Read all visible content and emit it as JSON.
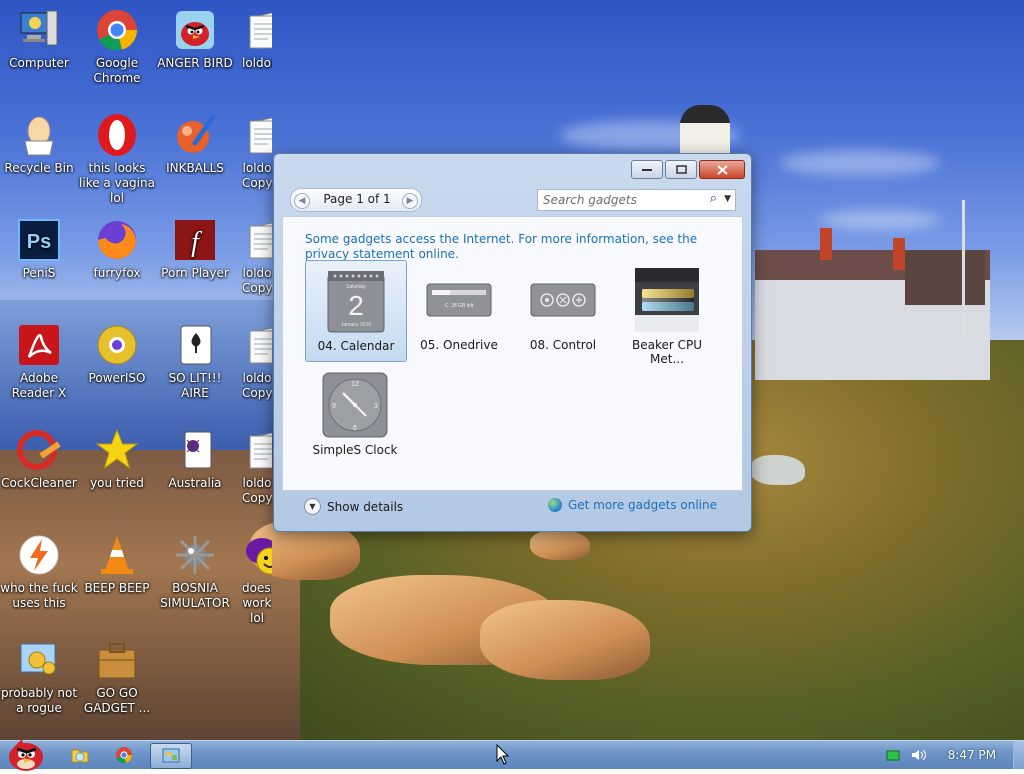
{
  "desktop": {
    "icons": [
      {
        "label": "Computer",
        "icon": "computer-icon"
      },
      {
        "label": "Google Chrome",
        "icon": "chrome-icon"
      },
      {
        "label": "ANGER BIRD",
        "icon": "angry-bird-icon"
      },
      {
        "label": "loldongs.txt",
        "icon": "text-file-icon"
      },
      {
        "label": "Recycle Bin",
        "icon": "recycle-bin-icon"
      },
      {
        "label": "this looks like a vagina lol",
        "icon": "opera-icon"
      },
      {
        "label": "INKBALLS",
        "icon": "inkball-icon"
      },
      {
        "label": "loldo Copy",
        "icon": "text-file-icon"
      },
      {
        "label": "PeniS",
        "icon": "photoshop-icon"
      },
      {
        "label": "furryfox",
        "icon": "firefox-icon"
      },
      {
        "label": "Porn Player",
        "icon": "flash-player-icon"
      },
      {
        "label": "loldo Copy",
        "icon": "text-file-icon"
      },
      {
        "label": "Adobe Reader X",
        "icon": "adobe-reader-icon"
      },
      {
        "label": "PowerISO",
        "icon": "poweriso-disc-icon"
      },
      {
        "label": "SO LIT!!! AIRE",
        "icon": "playing-card-icon"
      },
      {
        "label": "loldo Copy",
        "icon": "text-file-icon"
      },
      {
        "label": "CockCleaner",
        "icon": "ccleaner-icon"
      },
      {
        "label": "you tried",
        "icon": "star-icon"
      },
      {
        "label": "Australia",
        "icon": "spider-solitaire-icon"
      },
      {
        "label": "loldo Copy",
        "icon": "text-file-icon"
      },
      {
        "label": "who the fuck uses this",
        "icon": "lightning-icon"
      },
      {
        "label": "BEEP BEEP",
        "icon": "vlc-cone-icon"
      },
      {
        "label": "BOSNIA SIMULATOR",
        "icon": "minesweeper-mine-icon"
      },
      {
        "label": "doesn't work lol",
        "icon": "yahoo-messenger-icon"
      },
      {
        "label": "probably not a rogue",
        "icon": "control-panel-icon"
      },
      {
        "label": "GO GO GADGET ...",
        "icon": "gadget-briefcase-icon"
      }
    ]
  },
  "window": {
    "pager": {
      "label": "Page 1 of 1"
    },
    "search": {
      "placeholder": "Search gadgets"
    },
    "info_text": "Some gadgets access the Internet.  For more information, see the privacy statement online.",
    "gadgets": [
      {
        "label": "04. Calendar",
        "selected": true,
        "calendar_day": "2",
        "calendar_top": "Saturday",
        "calendar_bottom": "January 2010"
      },
      {
        "label": "05. Onedrive",
        "selected": false,
        "drive_text": "C: 28 GB left"
      },
      {
        "label": "08. Control",
        "selected": false
      },
      {
        "label": "Beaker CPU Met...",
        "selected": false
      },
      {
        "label": "SimpleS Clock",
        "selected": false
      }
    ],
    "footer": {
      "show_details": "Show details",
      "get_more": "Get more gadgets online"
    }
  },
  "taskbar": {
    "clock": "8:47 PM"
  },
  "colors": {
    "link": "#1f6fb9",
    "taskbar": "#6b93c6",
    "close_button": "#c9462c"
  }
}
